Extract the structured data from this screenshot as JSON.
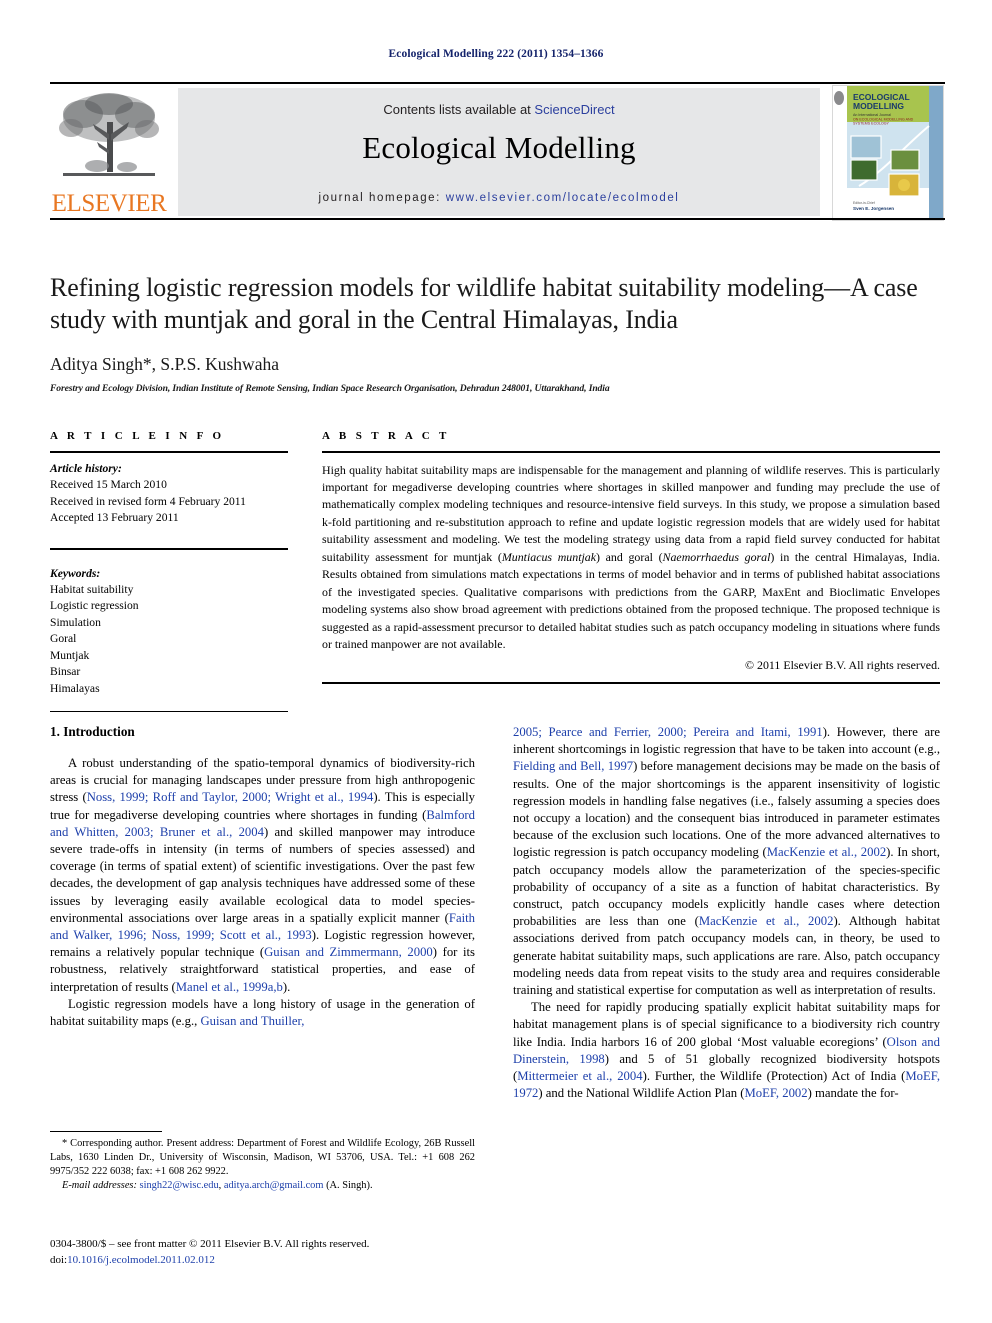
{
  "running_head": "Ecological Modelling 222 (2011) 1354–1366",
  "masthead": {
    "publisher": "ELSEVIER",
    "contents_prefix": "Contents lists available at ",
    "contents_link": "ScienceDirect",
    "journal_title": "Ecological Modelling",
    "homepage_prefix": "journal homepage:",
    "homepage_url": "www.elsevier.com/locate/ecolmodel",
    "cover_title_line1": "ECOLOGICAL",
    "cover_title_line2": "MODELLING",
    "link_color": "#2b3f9e",
    "brand_color": "#E87722"
  },
  "article": {
    "title": "Refining logistic regression models for wildlife habitat suitability modeling—A case study with muntjak and goral in the Central Himalayas, India",
    "authors": "Aditya Singh*, S.P.S. Kushwaha",
    "affiliation": "Forestry and Ecology Division, Indian Institute of Remote Sensing, Indian Space Research Organisation, Dehradun 248001, Uttarakhand, India"
  },
  "article_info": {
    "heading": "A R T I C L E    I N F O",
    "history_label": "Article history:",
    "history": [
      "Received 15 March 2010",
      "Received in revised form 4 February 2011",
      "Accepted 13 February 2011"
    ],
    "keywords_label": "Keywords:",
    "keywords": [
      "Habitat suitability",
      "Logistic regression",
      "Simulation",
      "Goral",
      "Muntjak",
      "Binsar",
      "Himalayas"
    ]
  },
  "abstract": {
    "heading": "A B S T R A C T",
    "text_part1": "High quality habitat suitability maps are indispensable for the management and planning of wildlife reserves. This is particularly important for megadiverse developing countries where shortages in skilled manpower and funding may preclude the use of mathematically complex modeling techniques and resource-intensive field surveys. In this study, we propose a simulation based k-fold partitioning and re-substitution approach to refine and update logistic regression models that are widely used for habitat suitability assessment and modeling. We test the modeling strategy using data from a rapid field survey conducted for habitat suitability assessment for muntjak (",
    "species1": "Muntiacus muntjak",
    "text_part2": ") and goral (",
    "species2": "Naemorrhaedus goral",
    "text_part3": ") in the central Himalayas, India. Results obtained from simulations match expectations in terms of model behavior and in terms of published habitat associations of the investigated species. Qualitative comparisons with predictions from the GARP, MaxEnt and Bioclimatic Envelopes modeling systems also show broad agreement with predictions obtained from the proposed technique. The proposed technique is suggested as a rapid-assessment precursor to detailed habitat studies such as patch occupancy modeling in situations where funds or trained manpower are not available.",
    "copyright": "© 2011 Elsevier B.V. All rights reserved."
  },
  "introduction": {
    "heading": "1.  Introduction",
    "left": {
      "p1_a": "A robust understanding of the spatio-temporal dynamics of biodiversity-rich areas is crucial for managing landscapes under pressure from high anthropogenic stress (",
      "p1_r1": "Noss, 1999; Roff and Taylor, 2000; Wright et al., 1994",
      "p1_b": "). This is especially true for megadiverse developing countries where shortages in funding (",
      "p1_r2": "Balmford and Whitten, 2003; Bruner et al., 2004",
      "p1_c": ") and skilled manpower may introduce severe trade-offs in intensity (in terms of numbers of species assessed) and coverage (in terms of spatial extent) of scientific investigations. Over the past few decades, the development of gap analysis techniques have addressed some of these issues by leveraging easily available ecological data to model species-environmental associations over large areas in a spatially explicit manner (",
      "p1_r3": "Faith and Walker, 1996; Noss, 1999; Scott et al., 1993",
      "p1_d": "). Logistic regression however, remains a relatively popular technique (",
      "p1_r4": "Guisan and Zimmermann, 2000",
      "p1_e": ") for its robustness, relatively straightforward statistical properties, and ease of interpretation of results (",
      "p1_r5": "Manel et al., 1999a,b",
      "p1_f": ").",
      "p2_a": "Logistic regression models have a long history of usage in the generation of habitat suitability maps (e.g., ",
      "p2_r1": "Guisan and Thuiller,"
    },
    "right": {
      "p1_r0": "2005; Pearce and Ferrier, 2000; Pereira and Itami, 1991",
      "p1_a": "). However, there are inherent shortcomings in logistic regression that have to be taken into account (e.g., ",
      "p1_r1": "Fielding and Bell, 1997",
      "p1_b": ") before management decisions may be made on the basis of results. One of the major shortcomings is the apparent insensitivity of logistic regression models in handling false negatives (i.e., falsely assuming a species does not occupy a location) and the consequent bias introduced in parameter estimates because of the exclusion such locations. One of the more advanced alternatives to logistic regression is patch occupancy modeling (",
      "p1_r2": "MacKenzie et al., 2002",
      "p1_c": "). In short, patch occupancy models allow the parameterization of the species-specific probability of occupancy of a site as a function of habitat characteristics. By construct, patch occupancy models explicitly handle cases where detection probabilities are less than one (",
      "p1_r3": "MacKenzie et al., 2002",
      "p1_d": "). Although habitat associations derived from patch occupancy models can, in theory, be used to generate habitat suitability maps, such applications are rare. Also, patch occupancy modeling needs data from repeat visits to the study area and requires considerable training and statistical expertise for computation as well as interpretation of results.",
      "p2_a": "The need for rapidly producing spatially explicit habitat suitability maps for habitat management plans is of special significance to a biodiversity rich country like India. India harbors 16 of 200 global ‘Most valuable ecoregions’ (",
      "p2_r1": "Olson and Dinerstein, 1998",
      "p2_b": ") and 5 of 51 globally recognized biodiversity hotspots (",
      "p2_r2": "Mittermeier et al., 2004",
      "p2_c": "). Further, the Wildlife (Protection) Act of India (",
      "p2_r3": "MoEF, 1972",
      "p2_d": ") and the National Wildlife Action Plan (",
      "p2_r4": "MoEF, 2002",
      "p2_e": ") mandate the for-"
    }
  },
  "footnotes": {
    "corresponding": "* Corresponding author. Present address: Department of Forest and Wildlife Ecology, 26B Russell Labs, 1630 Linden Dr., University of Wisconsin, Madison, WI 53706, USA. Tel.: +1 608 262 9975/352 222 6038; fax: +1 608 262 9922.",
    "email_label": "E-mail addresses:",
    "email1": "singh22@wisc.edu",
    "email2": "aditya.arch@gmail.com",
    "email_suffix": "(A. Singh)."
  },
  "imprint": {
    "issn_line": "0304-3800/$ – see front matter © 2011 Elsevier B.V. All rights reserved.",
    "doi_label": "doi:",
    "doi": "10.1016/j.ecolmodel.2011.02.012"
  }
}
